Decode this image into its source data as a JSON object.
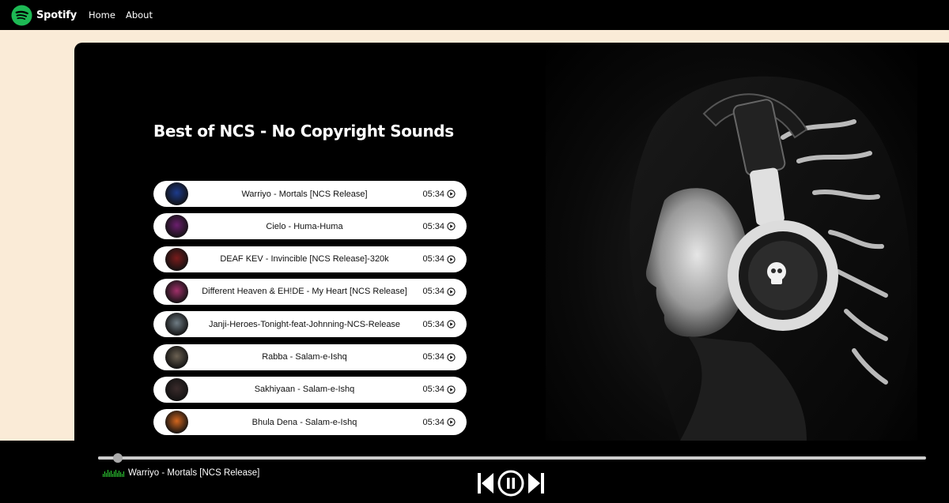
{
  "nav": {
    "brand": "Spotify",
    "links": [
      "Home",
      "About"
    ]
  },
  "playlist": {
    "title": "Best of NCS - No Copyright Sounds",
    "songs": [
      {
        "name": "Warriyo - Mortals [NCS Release]",
        "duration": "05:34",
        "thumb_color": "#1d3b8c"
      },
      {
        "name": "Cielo - Huma-Huma",
        "duration": "05:34",
        "thumb_color": "#6b1f6e"
      },
      {
        "name": "DEAF KEV - Invincible [NCS Release]-320k",
        "duration": "05:34",
        "thumb_color": "#7a1c1c"
      },
      {
        "name": "Different Heaven & EH!DE - My Heart [NCS Release]",
        "duration": "05:34",
        "thumb_color": "#a0306a"
      },
      {
        "name": "Janji-Heroes-Tonight-feat-Johnning-NCS-Release",
        "duration": "05:34",
        "thumb_color": "#6f7c84"
      },
      {
        "name": "Rabba - Salam-e-Ishq",
        "duration": "05:34",
        "thumb_color": "#6b6152"
      },
      {
        "name": "Sakhiyaan - Salam-e-Ishq",
        "duration": "05:34",
        "thumb_color": "#3a2b2b"
      },
      {
        "name": "Bhula Dena - Salam-e-Ishq",
        "duration": "05:34",
        "thumb_color": "#d2661e"
      }
    ]
  },
  "player": {
    "now_playing": "Warriyo - Mortals [NCS Release]",
    "progress_fraction": 0.024,
    "state": "playing"
  },
  "colors": {
    "accent": "#1DB954",
    "background": "#FAEBD7",
    "wave": "#2ED134"
  }
}
